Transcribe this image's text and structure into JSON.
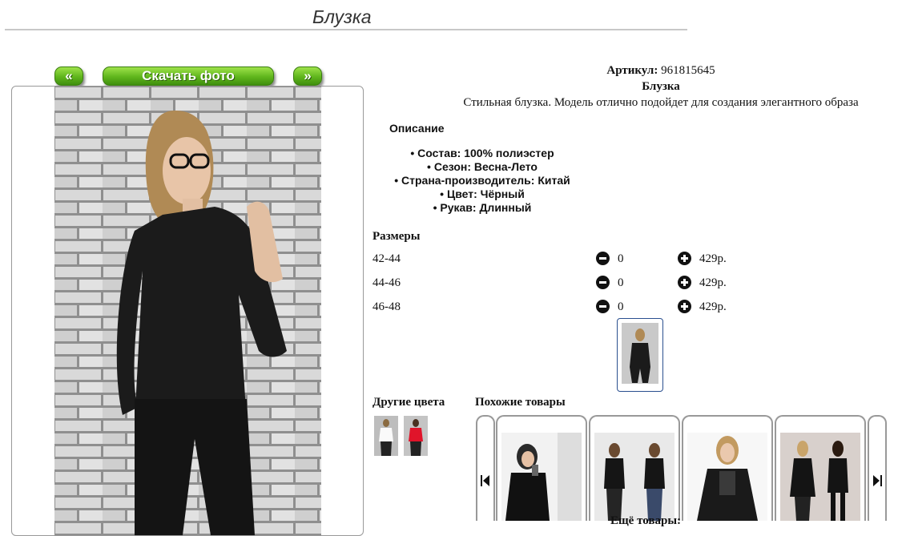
{
  "page": {
    "title": "Блузка"
  },
  "gallery": {
    "prev_label": "«",
    "download_label": "Скачать фото",
    "next_label": "»"
  },
  "product": {
    "sku_label": "Артикул:",
    "sku_value": "961815645",
    "name": "Блузка",
    "tagline": "Стильная блузка. Модель отлично подойдет для создания элегантного образа",
    "description_heading": "Описание",
    "features": [
      "Состав: 100% полиэстер",
      "Сезон: Весна-Лето",
      "Страна-производитель: Китай",
      "Цвет: Чёрный",
      "Рукав: Длинный"
    ]
  },
  "sizes": {
    "heading": "Размеры",
    "rows": [
      {
        "size": "42-44",
        "qty": "0",
        "price": "429р."
      },
      {
        "size": "44-46",
        "qty": "0",
        "price": "429р."
      },
      {
        "size": "46-48",
        "qty": "0",
        "price": "429р."
      }
    ]
  },
  "other_colors": {
    "heading": "Другие цвета",
    "items": [
      "white",
      "red"
    ]
  },
  "similar": {
    "heading": "Похожие товары",
    "more_label": "Ещё товары:"
  },
  "colors": {
    "button_green": "#5fb51c",
    "selected_border": "#2a4f8f"
  }
}
